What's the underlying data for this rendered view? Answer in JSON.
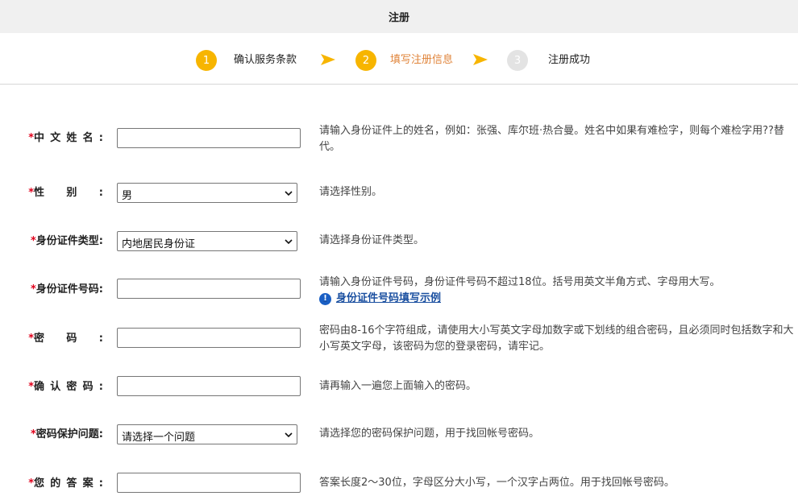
{
  "header": {
    "title": "注册"
  },
  "steps": [
    {
      "number": "1",
      "label": "确认服务条款",
      "state": "done"
    },
    {
      "number": "2",
      "label": "填写注册信息",
      "state": "current"
    },
    {
      "number": "3",
      "label": "注册成功",
      "state": "pending"
    }
  ],
  "colors": {
    "accent": "#f7b500",
    "current_step": "#e0843a",
    "required": "#e0001b",
    "link": "#1a4fa0"
  },
  "form": {
    "required_mark": "*",
    "fields": {
      "name": {
        "label": "中文姓名:",
        "value": "",
        "hint": "请输入身份证件上的姓名，例如：张强、库尔班·热合曼。姓名中如果有难检字，则每个难检字用??替代。"
      },
      "gender": {
        "label": "性别:",
        "selected": "男",
        "hint": "请选择性别。"
      },
      "id_type": {
        "label": "身份证件类型:",
        "selected": "内地居民身份证",
        "hint": "请选择身份证件类型。"
      },
      "id_number": {
        "label": "身份证件号码:",
        "value": "",
        "hint": "请输入身份证件号码，身份证件号码不超过18位。括号用英文半角方式、字母用大写。",
        "example_link": "身份证件号码填写示例",
        "example_icon": "info-icon"
      },
      "password": {
        "label": "密码:",
        "value": "",
        "hint": "密码由8-16个字符组成，请使用大小写英文字母加数字或下划线的组合密码，且必须同时包括数字和大小写英文字母，该密码为您的登录密码，请牢记。"
      },
      "confirm_password": {
        "label": "确认密码:",
        "value": "",
        "hint": "请再输入一遍您上面输入的密码。"
      },
      "security_question": {
        "label": "密码保护问题:",
        "selected": "请选择一个问题",
        "hint": "请选择您的密码保护问题，用于找回帐号密码。"
      },
      "security_answer": {
        "label": "您的答案:",
        "value": "",
        "hint": "答案长度2～30位，字母区分大小写，一个汉字占两位。用于找回帐号密码。"
      }
    }
  }
}
